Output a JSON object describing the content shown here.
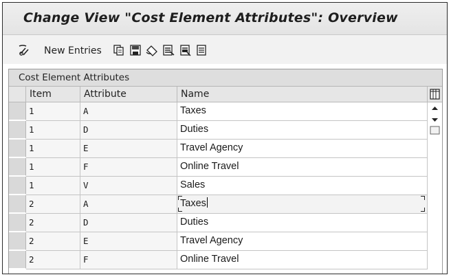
{
  "window": {
    "title": "Change View \"Cost Element Attributes\": Overview"
  },
  "toolbar": {
    "new_entries_label": "New Entries",
    "icons": [
      "glasses-change-icon",
      "copy-icon",
      "save-icon",
      "undo-icon",
      "select-all-icon",
      "select-block-icon",
      "deselect-all-icon"
    ]
  },
  "table": {
    "caption": "Cost Element Attributes",
    "columns": [
      "Item",
      "Attribute",
      "Name"
    ],
    "rows": [
      {
        "item": "1",
        "attribute": "A",
        "name": "Taxes"
      },
      {
        "item": "1",
        "attribute": "D",
        "name": "Duties"
      },
      {
        "item": "1",
        "attribute": "E",
        "name": "Travel Agency"
      },
      {
        "item": "1",
        "attribute": "F",
        "name": "Online Travel"
      },
      {
        "item": "1",
        "attribute": "V",
        "name": "Sales"
      },
      {
        "item": "2",
        "attribute": "A",
        "name": "Taxes"
      },
      {
        "item": "2",
        "attribute": "D",
        "name": "Duties"
      },
      {
        "item": "2",
        "attribute": "E",
        "name": "Travel Agency"
      },
      {
        "item": "2",
        "attribute": "F",
        "name": "Online Travel"
      }
    ],
    "active_row": 5
  },
  "colors": {
    "title_bar": "#e9e9e9",
    "header_gray": "#dedede",
    "frame_border": "#2a2a2a"
  }
}
